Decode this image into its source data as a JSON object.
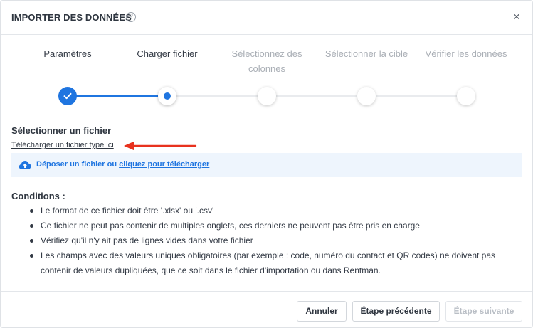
{
  "dialog": {
    "title": "IMPORTER DES DONNÉES",
    "help_icon": "question-circle-icon",
    "help_glyph": "?",
    "close_icon": "close-icon",
    "close_glyph": "×"
  },
  "stepper": {
    "steps": [
      {
        "label_line1": "Paramètres",
        "label_line2": "",
        "status": "done"
      },
      {
        "label_line1": "Charger fichier",
        "label_line2": "",
        "status": "current"
      },
      {
        "label_line1": "Sélectionnez des",
        "label_line2": "colonnes",
        "status": "pending"
      },
      {
        "label_line1": "Sélectionner la cible",
        "label_line2": "",
        "status": "pending"
      },
      {
        "label_line1": "Vérifier les données",
        "label_line2": "",
        "status": "pending"
      }
    ],
    "colors": {
      "active": "#1f75e0",
      "inactive_track": "#e9ebee",
      "inactive_label": "#a9aeb5"
    }
  },
  "file_section": {
    "title": "Sélectionner un fichier",
    "template_link": "Télécharger un fichier type ici",
    "annotation_arrow_color": "#e8321e",
    "dropzone_text": "Déposer un fichier ou ",
    "dropzone_link": "cliquez pour télécharger",
    "upload_icon": "cloud-upload-icon"
  },
  "conditions": {
    "title": "Conditions :",
    "items": [
      "Le format de ce fichier doit être '.xlsx' ou '.csv'",
      "Ce fichier ne peut pas contenir de multiples onglets, ces derniers ne peuvent pas être pris en charge",
      "Vérifiez qu'il n'y ait pas de lignes vides dans votre fichier",
      "Les champs avec des valeurs uniques obligatoires (par exemple : code, numéro du contact et QR codes) ne doivent pas contenir de valeurs dupliquées, que ce soit dans le fichier d'importation ou dans Rentman."
    ]
  },
  "footer": {
    "cancel_label": "Annuler",
    "prev_label": "Étape précédente",
    "next_label": "Étape suivante"
  }
}
